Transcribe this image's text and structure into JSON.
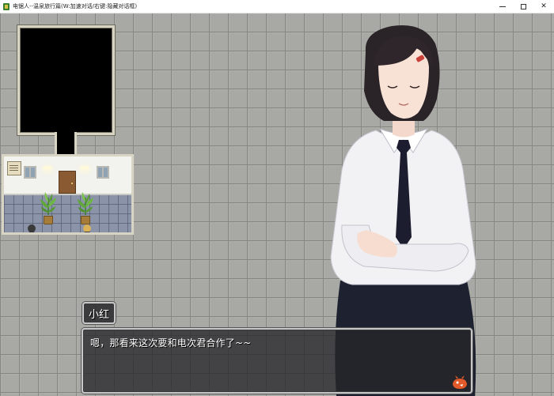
{
  "window": {
    "title": "电锯人--温泉旅行篇(W:加速对话/右键:隐藏对话框)",
    "controls": [
      "minimize-icon",
      "maximize-icon",
      "close-icon"
    ],
    "close_glyph": "✕"
  },
  "map": {
    "sprites": [
      {
        "name": "npc-sprite-dark-hair",
        "hair_color": "#3a3a3a",
        "outfit_color": "#2f3340"
      },
      {
        "name": "player-sprite-blonde",
        "hair_color": "#d9b25a",
        "outfit_color": "#3b3b3b"
      }
    ],
    "decor": [
      "calendar-icon",
      "window-icon",
      "lamp-icon",
      "door-icon",
      "potted-plant-icon"
    ]
  },
  "dialogue": {
    "speaker": "小红",
    "message": "嗯，那看来这次要和电次君合作了~~"
  },
  "colors": {
    "tile_background": "#a8a8a4",
    "message_box_bg": "#26262a",
    "message_border": "#c8c8c8",
    "text": "#ffffff"
  }
}
